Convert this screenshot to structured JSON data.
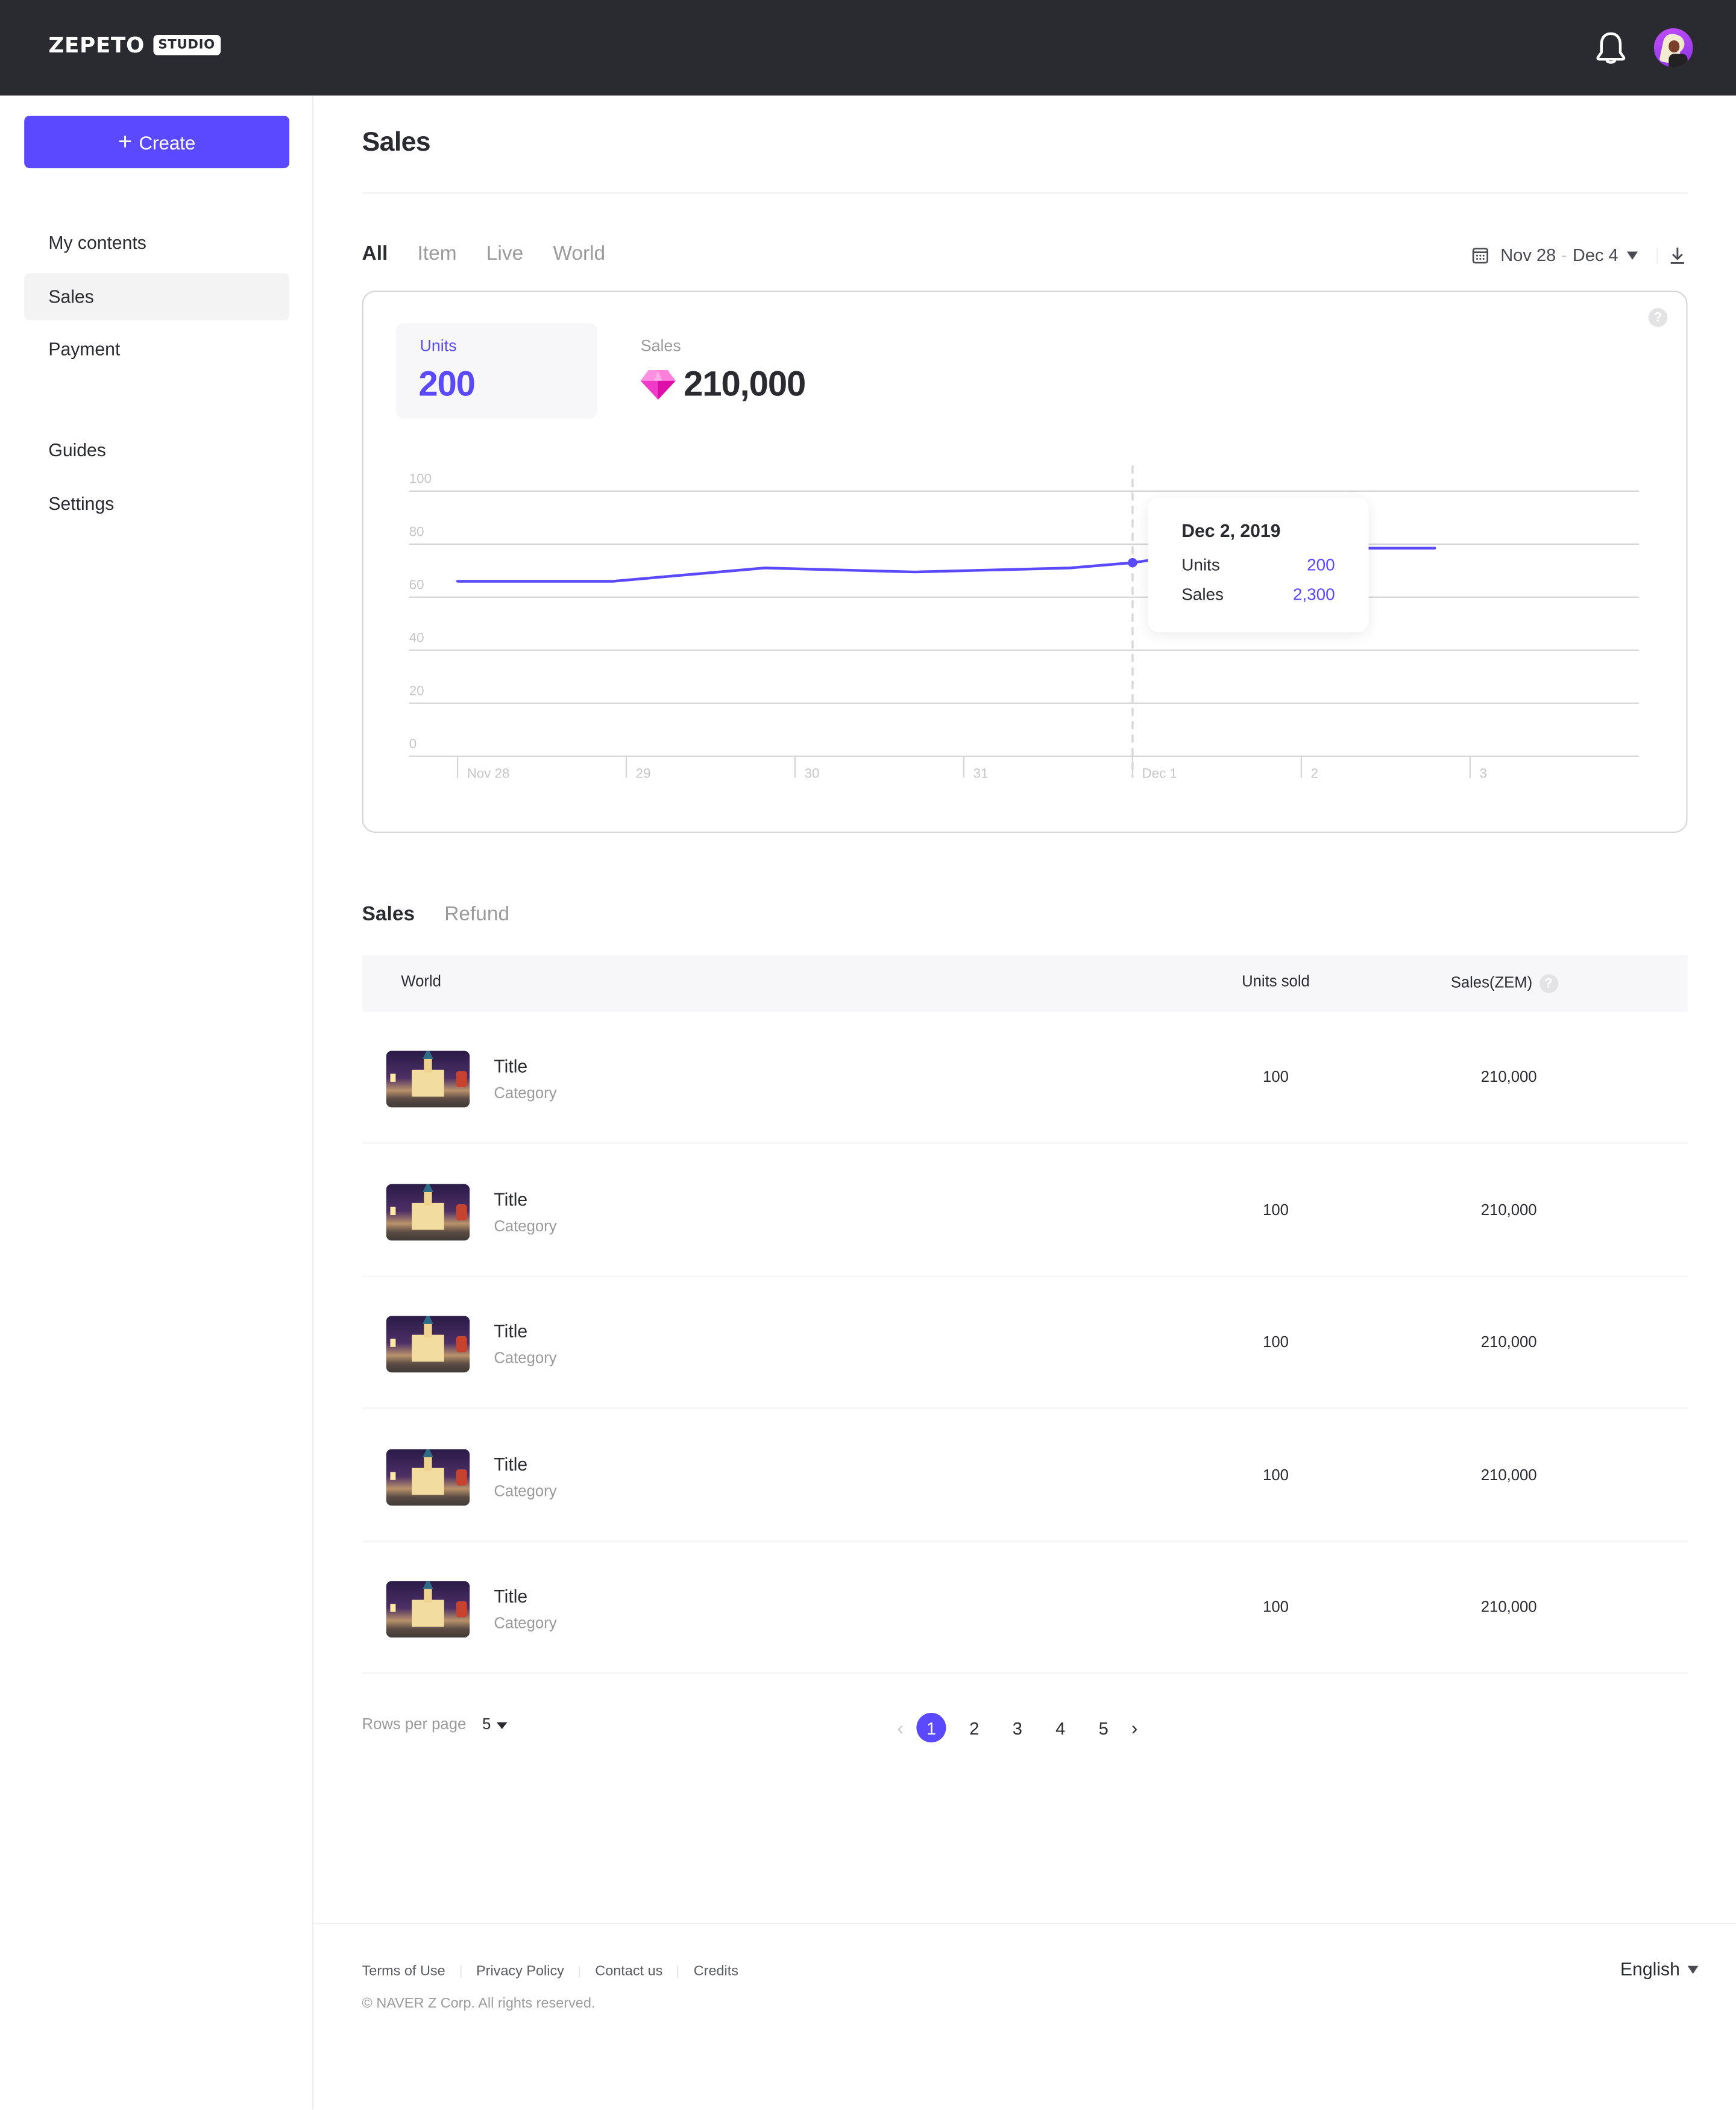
{
  "app": {
    "logo_text": "ZEPETO",
    "logo_badge": "STUDIO",
    "notification_icon": "bell-icon",
    "avatar_icon": "user-avatar"
  },
  "colors": {
    "accent": "#5b49ff",
    "header_bg": "#2a2b31",
    "text": "#2a2b31",
    "muted": "#9b9b9b",
    "gem_pink": "#f03bc8"
  },
  "sidebar": {
    "create_label": "Create",
    "create_icon": "plus-icon",
    "items": [
      {
        "label": "My contents",
        "active": false
      },
      {
        "label": "Sales",
        "active": true
      },
      {
        "label": "Payment",
        "active": false
      },
      {
        "label": "Guides",
        "active": false
      },
      {
        "label": "Settings",
        "active": false
      }
    ]
  },
  "page": {
    "title": "Sales",
    "tabs": [
      {
        "label": "All",
        "active": true
      },
      {
        "label": "Item",
        "active": false
      },
      {
        "label": "Live",
        "active": false
      },
      {
        "label": "World",
        "active": false
      }
    ],
    "date_range": {
      "icon": "calendar-icon",
      "start": "Nov 28",
      "separator": "-",
      "end": "Dec 4"
    },
    "download_icon": "download-icon"
  },
  "summary": {
    "units_label": "Units",
    "units_value": "200",
    "sales_label": "Sales",
    "sales_icon": "gem-icon",
    "sales_value": "210,000",
    "help_icon": "question-icon"
  },
  "chart_data": {
    "type": "line",
    "title": "",
    "xlabel": "",
    "ylabel": "",
    "x_ticks": [
      "Nov 28",
      "29",
      "30",
      "31",
      "Dec 1",
      "2",
      "3"
    ],
    "y_ticks": [
      0,
      20,
      40,
      60,
      80,
      100
    ],
    "ylim": [
      0,
      100
    ],
    "grid": true,
    "series": [
      {
        "name": "Units",
        "color": "#5b49ff",
        "points": [
          {
            "x": 0.0,
            "y": 66
          },
          {
            "x": 0.92,
            "y": 66
          },
          {
            "x": 1.82,
            "y": 71
          },
          {
            "x": 2.71,
            "y": 69.5
          },
          {
            "x": 3.63,
            "y": 71
          },
          {
            "x": 4.0,
            "y": 73
          },
          {
            "x": 4.6,
            "y": 78.5
          },
          {
            "x": 5.79,
            "y": 78.5
          }
        ]
      }
    ],
    "hover": {
      "x": 4.0,
      "y": 73
    },
    "tooltip": {
      "date": "Dec 2, 2019",
      "rows": [
        {
          "label": "Units",
          "value": "200"
        },
        {
          "label": "Sales",
          "value": "2,300"
        }
      ]
    }
  },
  "table": {
    "tabs": [
      {
        "label": "Sales",
        "active": true
      },
      {
        "label": "Refund",
        "active": false
      }
    ],
    "columns": [
      "World",
      "Units sold",
      "Sales(ZEM)"
    ],
    "rows": [
      {
        "title": "Title",
        "category": "Category",
        "units": "100",
        "sales": "210,000"
      },
      {
        "title": "Title",
        "category": "Category",
        "units": "100",
        "sales": "210,000"
      },
      {
        "title": "Title",
        "category": "Category",
        "units": "100",
        "sales": "210,000"
      },
      {
        "title": "Title",
        "category": "Category",
        "units": "100",
        "sales": "210,000"
      },
      {
        "title": "Title",
        "category": "Category",
        "units": "100",
        "sales": "210,000"
      }
    ]
  },
  "pagination": {
    "rows_per_page_label": "Rows per page",
    "rows_per_page_value": "5",
    "pages": [
      "1",
      "2",
      "3",
      "4",
      "5"
    ],
    "current_page": "1",
    "prev_icon": "chevron-left-icon",
    "next_icon": "chevron-right-icon"
  },
  "footer": {
    "links": [
      "Terms of Use",
      "Privacy Policy",
      "Contact us",
      "Credits"
    ],
    "copyright": "© NAVER Z Corp. All rights reserved.",
    "language": "English"
  }
}
